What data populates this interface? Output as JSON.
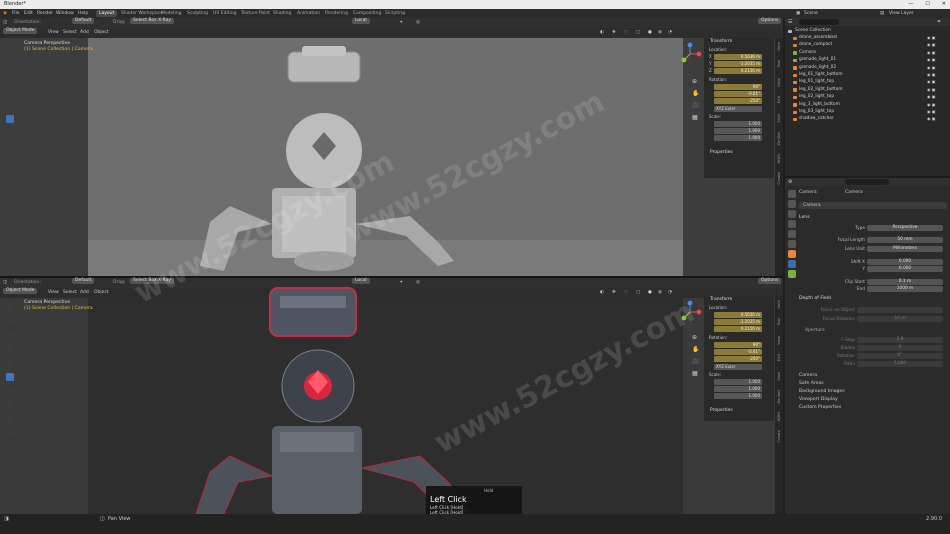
{
  "window": {
    "title": "Blender*"
  },
  "menu": {
    "items": [
      "File",
      "Edit",
      "Render",
      "Window",
      "Help"
    ],
    "workspaces": [
      "Layout",
      "Shader Workspace",
      "Modeling",
      "Sculpting",
      "UV Editing",
      "Texture Paint",
      "Shading",
      "Animation",
      "Rendering",
      "Compositing",
      "Scripting"
    ],
    "active_workspace": "Layout",
    "scene": "Scene",
    "view_layer": "View Layer"
  },
  "viewport_top": {
    "orientation_label": "Orientation:",
    "orientation": "Default",
    "drag_label": "Drag:",
    "drag": "Select Box X-Ray",
    "mode": "Object Mode",
    "menu": [
      "View",
      "Select",
      "Add",
      "Object"
    ],
    "transform": "Local",
    "options": "Options",
    "view_name": "Camera Perspective",
    "collection_info": "(1) Scene Collection | Camera"
  },
  "viewport_bottom": {
    "orientation_label": "Orientation:",
    "orientation": "Default",
    "drag_label": "Drag:",
    "drag": "Select Box X-Ray",
    "mode": "Object Mode",
    "menu": [
      "View",
      "Select",
      "Add",
      "Object"
    ],
    "transform": "Local",
    "options": "Options",
    "view_name": "Camera Perspective",
    "collection_info": "(1) Scene Collection | Camera"
  },
  "npanel_top": {
    "transform_title": "Transform",
    "location_label": "Location:",
    "location": [
      "0.5636 m",
      "-1.2035 m",
      "0.2156 m"
    ],
    "rotation_label": "Rotation:",
    "rotation": [
      "90°",
      "-0.01°",
      "-250°"
    ],
    "rotation_mode": "XYZ Euler",
    "scale_label": "Scale:",
    "scale": [
      "1.000",
      "1.000",
      "1.000"
    ],
    "properties_title": "Properties",
    "axes": [
      "X",
      "Y",
      "Z"
    ],
    "tabs": [
      "Item",
      "Tool",
      "View",
      "Edit",
      "Shot",
      "ZenSet",
      "HDRI",
      "Create"
    ]
  },
  "npanel_bottom": {
    "transform_title": "Transform",
    "location_label": "Location:",
    "location": [
      "0.5636 m",
      "-1.2035 m",
      "0.2156 m"
    ],
    "rotation_label": "Rotation:",
    "rotation": [
      "90°",
      "-0.01°",
      "-250°"
    ],
    "rotation_mode": "XYZ Euler",
    "scale_label": "Scale:",
    "scale": [
      "1.000",
      "1.000",
      "1.000"
    ],
    "properties_title": "Properties",
    "axes": [
      "X",
      "Y",
      "Z"
    ],
    "tabs": [
      "Item",
      "Tool",
      "View",
      "Edit",
      "Shot",
      "ZenSet",
      "HDRI",
      "Create"
    ]
  },
  "outliner": {
    "root": "Scene Collection",
    "items": [
      "drone_assembled",
      "drone_compact",
      "Camera",
      "grenade_light_01",
      "grenade_light_02",
      "leg_01_light_bottom",
      "leg_01_light_top",
      "leg_02_light_bottom",
      "leg_02_light_top",
      "leg_3_light_bottom",
      "leg_03_light_top",
      "shadow_catcher"
    ]
  },
  "properties": {
    "object_name": "Camera",
    "data_name": "Camera",
    "datablock": "Camera",
    "lens_section": "Lens",
    "type_label": "Type",
    "type": "Perspective",
    "focal_label": "Focal Length",
    "focal": "50 mm",
    "lens_unit_label": "Lens Unit",
    "lens_unit": "Millimeters",
    "shift_x_label": "Shift X",
    "shift_x": "0.000",
    "shift_y_label": "Y",
    "shift_y": "0.000",
    "clip_start_label": "Clip Start",
    "clip_start": "0.1 m",
    "clip_end_label": "End",
    "clip_end": "1000 m",
    "dof_section": "Depth of Field",
    "focus_obj_label": "Focus on Object",
    "focus_dist_label": "Focus Distance",
    "focus_dist": "10 m",
    "aperture_section": "Aperture",
    "fstop_label": "F-Stop",
    "fstop": "2.8",
    "blades_label": "Blades",
    "blades": "0",
    "rotation_label": "Rotation",
    "rotation": "0°",
    "ratio_label": "Ratio",
    "ratio": "1.000",
    "sections": [
      "Camera",
      "Safe Areas",
      "Background Images",
      "Viewport Display",
      "Custom Properties"
    ]
  },
  "status": {
    "left": "Pan View",
    "right": "2.90.0"
  },
  "key_overlay": {
    "hold": "Hold",
    "title": "Left Click",
    "lines": [
      "Left Click [Hold]",
      "Left Click [Hold]"
    ]
  },
  "watermark": {
    "text": "www.52cgzy.com"
  },
  "colors": {
    "selected_field": "#8c7b36",
    "active_tool": "#4772b3",
    "x_axis": "#e8475a",
    "y_axis": "#8ccc2e",
    "z_axis": "#4a8ce8",
    "light_icon": "#e8863a"
  }
}
